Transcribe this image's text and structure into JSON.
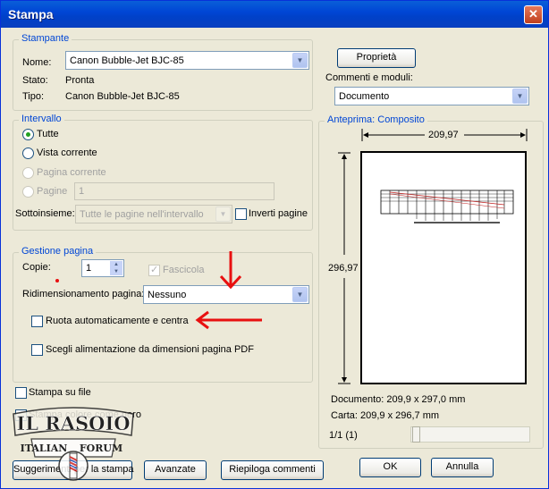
{
  "window": {
    "title": "Stampa"
  },
  "printer": {
    "group_label": "Stampante",
    "name_label": "Nome:",
    "name_value": "Canon Bubble-Jet BJC-85",
    "status_label": "Stato:",
    "status_value": "Pronta",
    "type_label": "Tipo:",
    "type_value": "Canon Bubble-Jet BJC-85",
    "properties_button": "Proprietà",
    "comments_label": "Commenti e moduli:",
    "comments_value": "Documento"
  },
  "range": {
    "group_label": "Intervallo",
    "all": "Tutte",
    "current_view": "Vista corrente",
    "current_page": "Pagina corrente",
    "pages": "Pagine",
    "pages_value": "1",
    "subset_label": "Sottoinsieme:",
    "subset_value": "Tutte le pagine nell'intervallo",
    "reverse_pages": "Inverti pagine"
  },
  "page_handling": {
    "group_label": "Gestione pagina",
    "copies_label": "Copie:",
    "copies_value": "1",
    "collate": "Fascicola",
    "scaling_label": "Ridimensionamento pagina:",
    "scaling_value": "Nessuno",
    "auto_rotate": "Ruota automaticamente e centra",
    "choose_paper": "Scegli alimentazione da dimensioni pagina PDF"
  },
  "options": {
    "print_to_file": "Stampa su file",
    "print_color_as_black": "Stampa colore come nero"
  },
  "preview": {
    "group_label": "Anteprima: Composito",
    "width": "209,97",
    "height": "296,97",
    "document_size": "Documento: 209,9 x 297,0 mm",
    "paper_size": "Carta: 209,9 x 296,7 mm",
    "page_counter": "1/1 (1)"
  },
  "buttons": {
    "tips": "Suggerimenti per la stampa",
    "advanced": "Avanzate",
    "summarize": "Riepiloga commenti",
    "ok": "OK",
    "cancel": "Annulla"
  },
  "watermark": {
    "line1": "IL RASOIO",
    "line2": "ITALIAN",
    "line3": "FORUM"
  },
  "colors": {
    "accent": "#0046d5",
    "annotation": "#e81010"
  }
}
